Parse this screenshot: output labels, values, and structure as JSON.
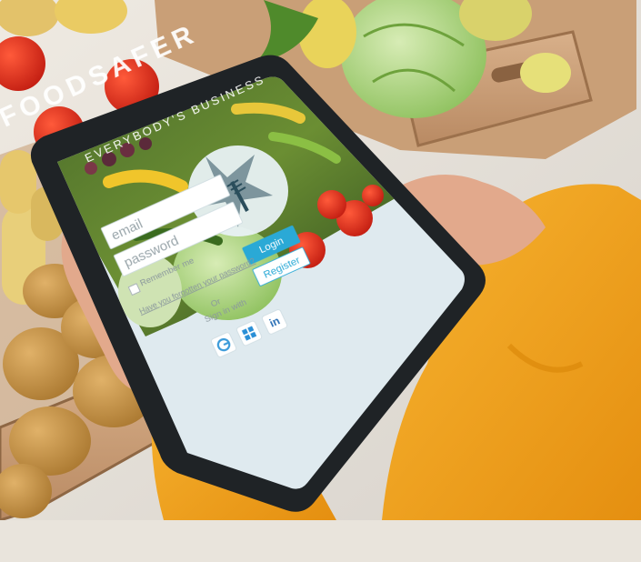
{
  "brand": {
    "name": "FOODSAFER",
    "tagline": "EVERYBODY'S BUSINESS"
  },
  "login": {
    "email_placeholder": "email",
    "password_placeholder": "password",
    "login_label": "Login",
    "register_label": "Register",
    "remember_label": "Remember me",
    "forgot_label": "Have you forgotten your password?",
    "or_label": "Or",
    "sign_in_with_label": "Sign in with"
  },
  "social": {
    "icons": [
      "linkedin-icon",
      "windows-icon",
      "google-icon"
    ]
  },
  "colors": {
    "accent": "#2aa9d6",
    "ui_background": "#dfeaef",
    "sweater": "#f2a31d",
    "tablet_frame": "#1f2326"
  }
}
